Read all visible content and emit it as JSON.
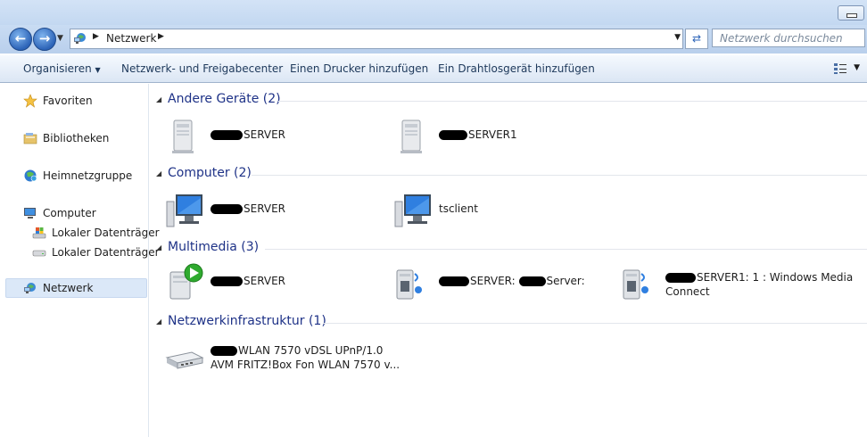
{
  "address": {
    "crumb": "Netzwerk",
    "search_placeholder": "Netzwerk durchsuchen"
  },
  "toolbar": {
    "organize": "Organisieren",
    "network_center": "Netzwerk- und Freigabecenter",
    "add_printer": "Einen Drucker hinzufügen",
    "add_wireless": "Ein Drahtlosgerät hinzufügen"
  },
  "sidebar": {
    "items": [
      {
        "label": "Favoriten",
        "icon": "star-icon"
      },
      {
        "label": "Bibliotheken",
        "icon": "library-icon"
      },
      {
        "label": "Heimnetzgruppe",
        "icon": "homegroup-icon"
      },
      {
        "label": "Computer",
        "icon": "computer-icon"
      },
      {
        "label": "Lokaler Datenträger",
        "icon": "drive-icon"
      },
      {
        "label": "Lokaler Datenträger",
        "icon": "drive-icon"
      },
      {
        "label": "Netzwerk",
        "icon": "network-icon"
      }
    ]
  },
  "groups": [
    {
      "title": "Andere Geräte (2)",
      "items": [
        {
          "name": "SERVER",
          "icon": "server-icon"
        },
        {
          "name": "SERVER1",
          "icon": "server-icon"
        }
      ]
    },
    {
      "title": "Computer (2)",
      "items": [
        {
          "name": "SERVER",
          "icon": "computer-monitor-icon"
        },
        {
          "name": "tsclient",
          "icon": "computer-monitor-icon"
        }
      ]
    },
    {
      "title": "Multimedia (3)",
      "items": [
        {
          "name": "SERVER",
          "icon": "media-server-icon"
        },
        {
          "name": "SERVER:",
          "name2": "Server:",
          "icon": "media-device-icon"
        },
        {
          "name": "SERVER1: 1 : Windows Media",
          "name2": "Connect",
          "icon": "media-device-icon"
        }
      ]
    },
    {
      "title": "Netzwerkinfrastruktur (1)",
      "items": [
        {
          "name": "WLAN 7570 vDSL UPnP/1.0",
          "name2": "AVM FRITZ!Box Fon WLAN 7570 v...",
          "icon": "router-icon"
        }
      ]
    }
  ]
}
